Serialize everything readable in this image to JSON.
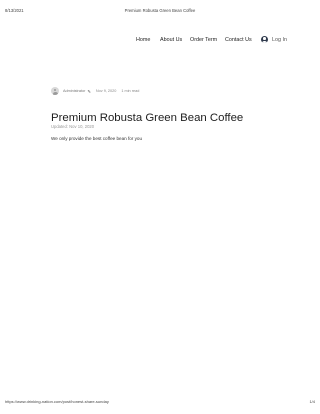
{
  "print_header": {
    "date": "8/13/2021",
    "title": "Premium Robusta Green Bean Coffee"
  },
  "nav": {
    "items": [
      "Home",
      "About Us",
      "Order Term",
      "Contact Us"
    ],
    "login_label": "Log In",
    "login_icon": "user-avatar-icon"
  },
  "post": {
    "author": "Administrator",
    "author_icon": "crown-icon",
    "date": "Nov 9, 2020",
    "read_time": "1 min read",
    "title": "Premium Robusta Green Bean Coffee",
    "updated": "Updated: Nov 10, 2020",
    "body": "We only provide the best coffee bean for you"
  },
  "print_footer": {
    "url": "https://www.drinking-nation.com/post/honest-share-sunday",
    "page": "1/4"
  }
}
